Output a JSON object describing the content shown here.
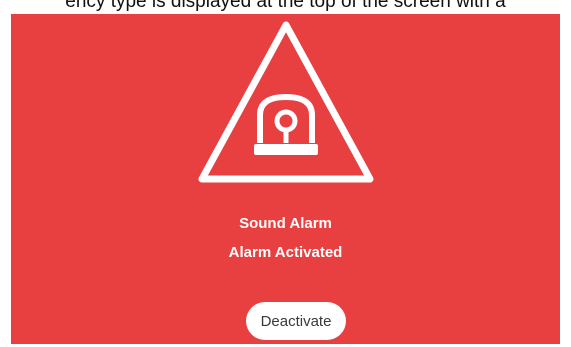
{
  "caption": {
    "text": "ency type is displayed at the top of the screen with a"
  },
  "screen": {
    "background": "#e84040",
    "icon": "siren-warning-triangle-icon",
    "title": "Sound Alarm",
    "status": "Alarm Activated"
  },
  "actions": {
    "deactivate_label": "Deactivate"
  }
}
